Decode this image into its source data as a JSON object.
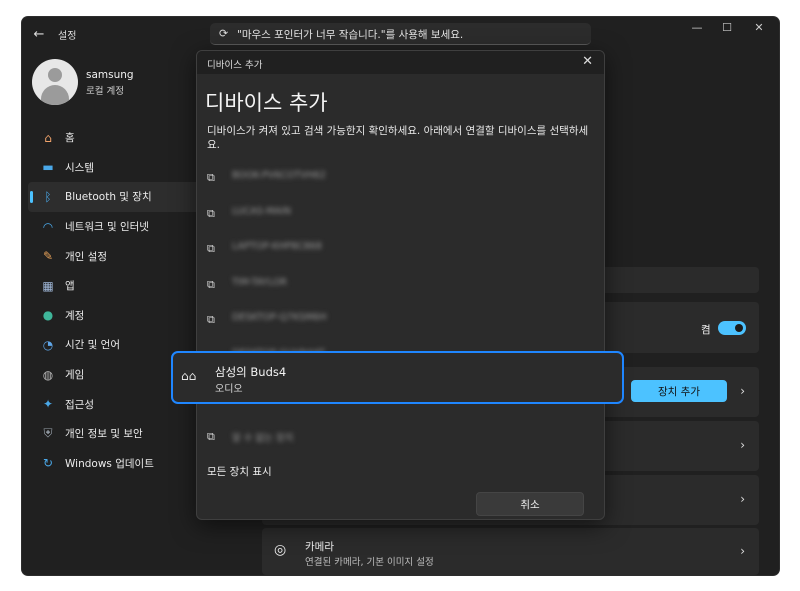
{
  "app": {
    "title": "설정",
    "back_icon": "←"
  },
  "search": {
    "icon": "⟳",
    "text": "\"마우스 포인터가 너무 작습니다.\"를 사용해 보세요."
  },
  "window_controls": {
    "minimize": "—",
    "maximize": "☐",
    "close": "✕"
  },
  "profile": {
    "name": "samsung",
    "account_type": "로컬 계정"
  },
  "sidebar": {
    "selected_index": 2,
    "accent_color": "#4cc2ff",
    "items": [
      {
        "label": "홈",
        "icon": "⌂",
        "icon_color": "#f0a36b"
      },
      {
        "label": "시스템",
        "icon": "▬",
        "icon_color": "#4aa8e8"
      },
      {
        "label": "Bluetooth 및 장치",
        "icon": "ᛒ",
        "icon_color": "#4aa8e8"
      },
      {
        "label": "네트워크 및 인터넷",
        "icon": "◠",
        "icon_color": "#4aa8e8"
      },
      {
        "label": "개인 설정",
        "icon": "✎",
        "icon_color": "#e9a35a"
      },
      {
        "label": "앱",
        "icon": "▦",
        "icon_color": "#9fb7d8"
      },
      {
        "label": "계정",
        "icon": "●",
        "icon_color": "#3fb69a"
      },
      {
        "label": "시간 및 언어",
        "icon": "◔",
        "icon_color": "#5fa6e8"
      },
      {
        "label": "게임",
        "icon": "◍",
        "icon_color": "#b9b9b9"
      },
      {
        "label": "접근성",
        "icon": "✦",
        "icon_color": "#4aa8e8"
      },
      {
        "label": "개인 정보 및 보안",
        "icon": "⛨",
        "icon_color": "#9aa3ad"
      },
      {
        "label": "Windows 업데이트",
        "icon": "↻",
        "icon_color": "#4aa8e8"
      }
    ]
  },
  "main": {
    "bluetooth_toggle": {
      "label": "켬",
      "on": true
    },
    "add_device_button": "장치 추가",
    "camera": {
      "title": "카메라",
      "subtitle": "연결된 카메라, 기본 이미지 설정",
      "icon": "◎"
    },
    "chevron": "›"
  },
  "dialog": {
    "title": "디바이스 추가",
    "heading": "디바이스 추가",
    "instruction": "디바이스가 켜져 있고 검색 가능한지 확인하세요. 아래에서 연결할 디바이스를 선택하세요.",
    "close_icon": "✕",
    "device_icon": "⧉",
    "devices": [
      "BOOK-PV6COTVH62",
      "LUCAS-MAIN",
      "LAPTOP-KHP8C868",
      "TIM-TAYLOR",
      "DESKTOP-Q7KSM6H",
      "DESKTOP-GUVN4AT"
    ],
    "highlighted_device": {
      "name": "삼성의 Buds4",
      "type": "오디오",
      "icon": "⌂⌂"
    },
    "hidden_item": "알 수 없는 장치",
    "show_all": "모든 장치 표시",
    "cancel": "취소"
  },
  "colors": {
    "highlight_border": "#1f86ff",
    "primary_button": "#4cc2ff"
  }
}
